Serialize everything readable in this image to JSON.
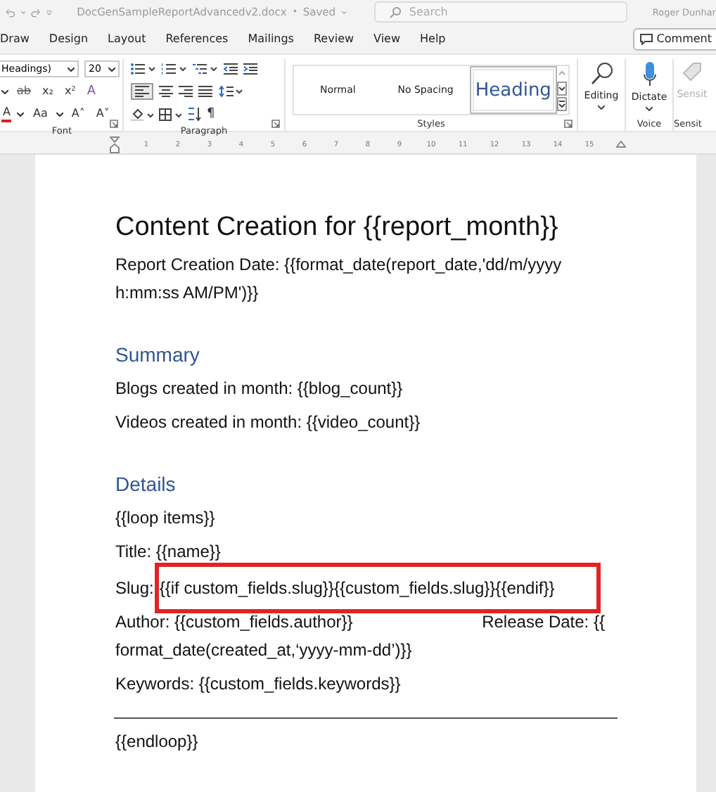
{
  "title_bar": {
    "document_title": "DocGenSampleReportAdvancedv2.docx",
    "separator": "•",
    "save_state": "Saved",
    "search": {
      "placeholder": "Search"
    },
    "user_name": "Roger Dunhar"
  },
  "tabs": [
    {
      "label": "Draw",
      "selected": false
    },
    {
      "label": "Design",
      "selected": false
    },
    {
      "label": "Layout",
      "selected": false
    },
    {
      "label": "References",
      "selected": false
    },
    {
      "label": "Mailings",
      "selected": false
    },
    {
      "label": "Review",
      "selected": false
    },
    {
      "label": "View",
      "selected": false
    },
    {
      "label": "Help",
      "selected": false
    }
  ],
  "comments_button": "Comment",
  "ribbon": {
    "font": {
      "font_name": "Headings)",
      "font_size": "20",
      "format_buttons": [
        "ab",
        "x₂",
        "x²",
        "A"
      ],
      "second_row": [
        "A",
        "Aa",
        "A˄",
        "A˅"
      ],
      "label": "Font"
    },
    "paragraph": {
      "pilcrow": "¶",
      "label": "Paragraph"
    },
    "styles": {
      "items": [
        {
          "label": "Normal",
          "selected": false
        },
        {
          "label": "No Spacing",
          "selected": false
        },
        {
          "label": "Heading",
          "selected": true
        }
      ],
      "label": "Styles"
    },
    "editing": {
      "label": "Editing"
    },
    "voice": {
      "button": "Dictate",
      "label": "Voice"
    },
    "sensitivity": {
      "button": "Sensit",
      "label": "Sensit",
      "disabled": true
    }
  },
  "ruler": [
    "1",
    "2",
    "3",
    "4",
    "5",
    "6",
    "7",
    "8",
    "9",
    "10",
    "11",
    "12",
    "13",
    "14",
    "15"
  ],
  "document": {
    "heading": "Content Creation for {{report_month}}",
    "report_date": "Report Creation Date: {{format_date(report_date,'dd/m/yyyy h:mm:ss AM/PM')}}",
    "summary_heading": "Summary",
    "summary_lines": [
      "Blogs created in month: {{blog_count}}",
      "Videos created in month: {{video_count}}"
    ],
    "details_heading": "Details",
    "loop_start": "{{loop items}}",
    "title_line": "Title: {{name}}",
    "slug_label": "Slug:",
    "slug_value": "{{if custom_fields.slug}}{{custom_fields.slug}}{{endif}}",
    "author": "Author: {{custom_fields.author}}",
    "release_date": "Release Date: {{",
    "release_date_continued": "format_date(created_at,‘yyyy-mm-dd’)}}",
    "keywords": "Keywords: {{custom_fields.keywords}}",
    "loop_end": "{{endloop}}"
  }
}
